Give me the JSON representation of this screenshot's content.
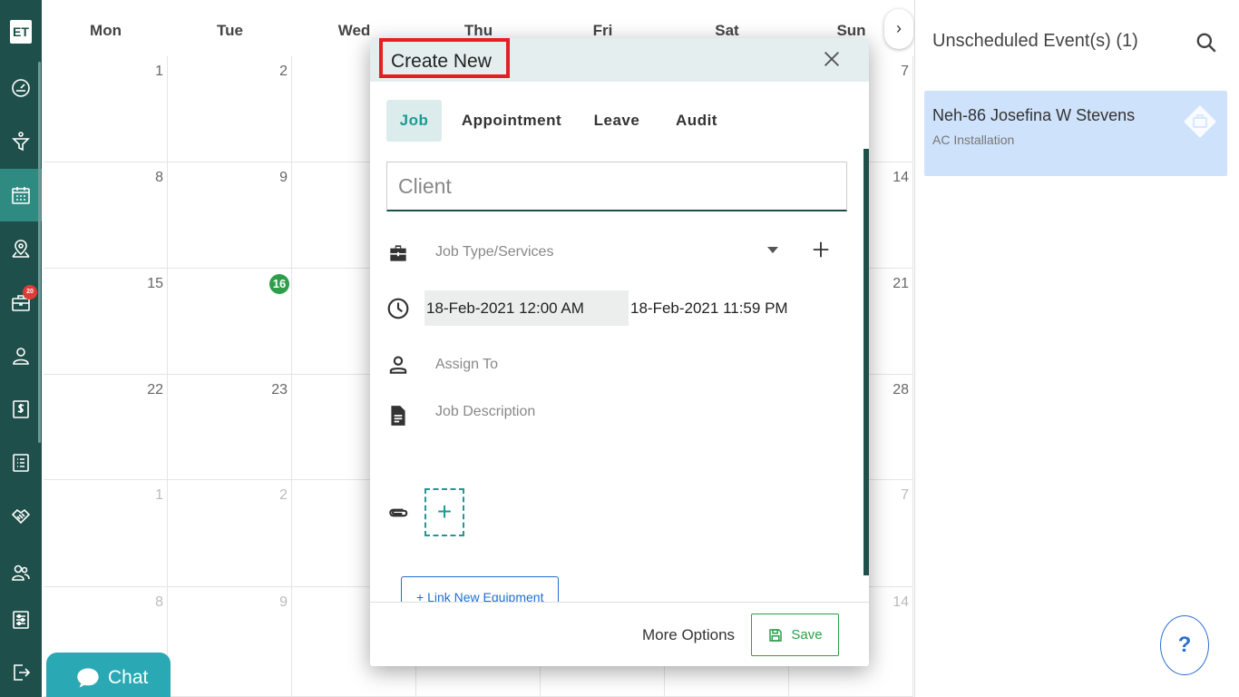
{
  "sidebar": {
    "logo": "ET",
    "jobs_badge": "20"
  },
  "calendar": {
    "days": [
      "Mon",
      "Tue",
      "Wed",
      "Thu",
      "Fri",
      "Sat",
      "Sun"
    ],
    "weeks": [
      {
        "mon": "1",
        "tue": "2",
        "sun": "7"
      },
      {
        "mon": "8",
        "tue": "9",
        "sun": "14"
      },
      {
        "mon": "15",
        "tue": "16",
        "sun": "21"
      },
      {
        "mon": "22",
        "tue": "23",
        "sun": "28"
      },
      {
        "mon": "1",
        "tue": "2",
        "sun": "7"
      },
      {
        "mon": "8",
        "tue": "9",
        "sun": "14"
      }
    ],
    "collapse_glyph": "›"
  },
  "right_panel": {
    "title": "Unscheduled Event(s) (1)",
    "event": {
      "title": "Neh-86 Josefina W Stevens",
      "subtitle": "AC Installation"
    },
    "help_label": "?"
  },
  "chat": {
    "label": "Chat"
  },
  "modal": {
    "title": "Create New",
    "tabs": [
      "Job",
      "Appointment",
      "Leave",
      "Audit"
    ],
    "active_tab": "Job",
    "client_placeholder": "Client",
    "job_type_placeholder": "Job Type/Services",
    "start_datetime": "18-Feb-2021 12:00 AM",
    "end_datetime": "18-Feb-2021 11:59 PM",
    "assign_placeholder": "Assign To",
    "description_placeholder": "Job Description",
    "attach_add_label": "+",
    "link_equipment_label": "+ Link New Equipment",
    "more_options_label": "More Options",
    "save_label": "Save"
  },
  "colors": {
    "sidebar": "#1f4f4a",
    "accent": "#1d9a92",
    "save_green": "#2e9e4a",
    "title_highlight": "#e32026",
    "event_card": "#cfe2fb"
  }
}
